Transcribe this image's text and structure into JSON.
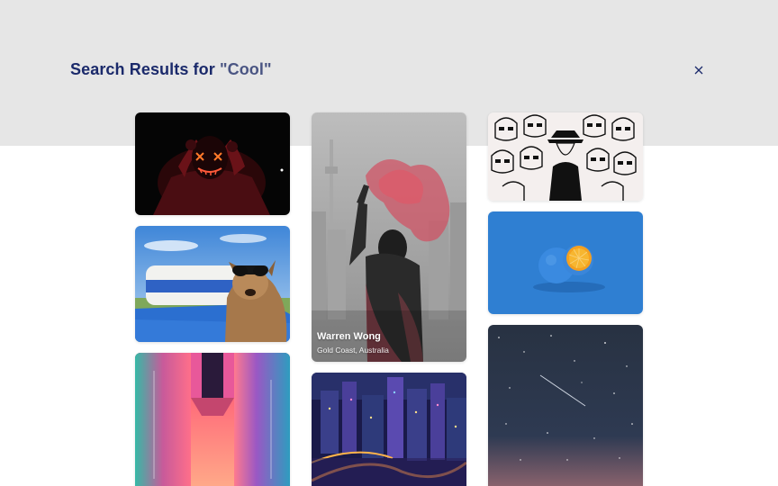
{
  "header": {
    "title_prefix": "Search Results for ",
    "query_display": "\"Cool\""
  },
  "icons": {
    "close": "close-icon"
  },
  "colors": {
    "header_bg": "#e6e6e6",
    "title": "#1b2a6b"
  },
  "results": [
    {
      "subject": "neon-mask-person"
    },
    {
      "subject": "dog-with-sunglasses"
    },
    {
      "subject": "neon-corridor"
    },
    {
      "subject": "smoke-flare-person",
      "photographer": "Warren Wong",
      "location": "Gold Coast, Australia"
    },
    {
      "subject": "city-night-lights"
    },
    {
      "subject": "stormtrooper-crowd"
    },
    {
      "subject": "blue-orange"
    },
    {
      "subject": "starry-sky"
    }
  ]
}
